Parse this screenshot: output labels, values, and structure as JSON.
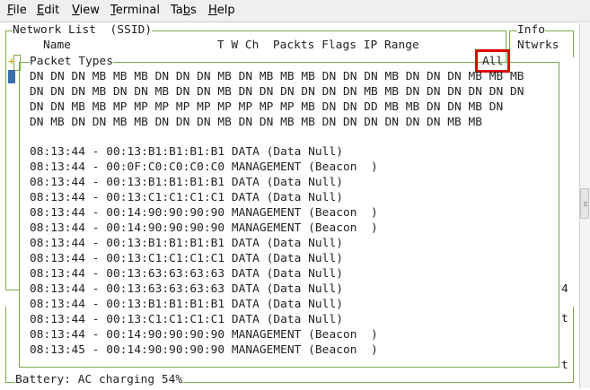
{
  "menu": {
    "items": [
      "File",
      "Edit",
      "View",
      "Terminal",
      "Tabs",
      "Help"
    ]
  },
  "network_panel": {
    "title": "Network List  (SSID)",
    "columns": "Name                     T W Ch  Packts Flags IP Range"
  },
  "info_panel": {
    "title": "Info",
    "label": "Ntwrks",
    "count": "4",
    "marker_1": "t",
    "marker_2": "t"
  },
  "packet_panel": {
    "title": "Packet Types",
    "filter": "All",
    "plus": "+",
    "type_rows": [
      "DN DN DN MB MB MB DN DN DN MB DN MB MB MB DN DN DN MB DN DN DN MB MB MB",
      "DN DN DN MB DN DN MB DN DN MB DN DN DN DN DN DN MB MB DN DN DN DN DN DN",
      "DN DN MB MB MP MP MP MP MP MP MP MP MP MB DN DN DD MB MB DN DN MB DN",
      "DN MB DN DN MB MB DN DN DN MB DN DN MB MB DN DN DN DN DN DN MB MB"
    ],
    "log_lines": [
      "08:13:44 - 00:13:B1:B1:B1:B1 DATA (Data Null)",
      "08:13:44 - 00:0F:C0:C0:C0:C0 MANAGEMENT (Beacon  )",
      "08:13:44 - 00:13:B1:B1:B1:B1 DATA (Data Null)",
      "08:13:44 - 00:13:C1:C1:C1:C1 DATA (Data Null)",
      "08:13:44 - 00:14:90:90:90:90 MANAGEMENT (Beacon  )",
      "08:13:44 - 00:14:90:90:90:90 MANAGEMENT (Beacon  )",
      "08:13:44 - 00:13:B1:B1:B1:B1 DATA (Data Null)",
      "08:13:44 - 00:13:C1:C1:C1:C1 DATA (Data Null)",
      "08:13:44 - 00:13:63:63:63:63 DATA (Data Null)",
      "08:13:44 - 00:13:63:63:63:63 DATA (Data Null)",
      "08:13:44 - 00:13:B1:B1:B1:B1 DATA (Data Null)",
      "08:13:44 - 00:13:C1:C1:C1:C1 DATA (Data Null)",
      "08:13:44 - 00:14:90:90:90:90 MANAGEMENT (Beacon  )",
      "08:13:45 - 00:14:90:90:90:90 MANAGEMENT (Beacon  )"
    ]
  },
  "status": {
    "battery": "Battery: AC charging 54%"
  },
  "colors": {
    "frame": "#7aa84a",
    "highlight": "#e00000",
    "text": "#222222"
  },
  "icons": [
    "scrollbar-thumb-grip-icon"
  ]
}
